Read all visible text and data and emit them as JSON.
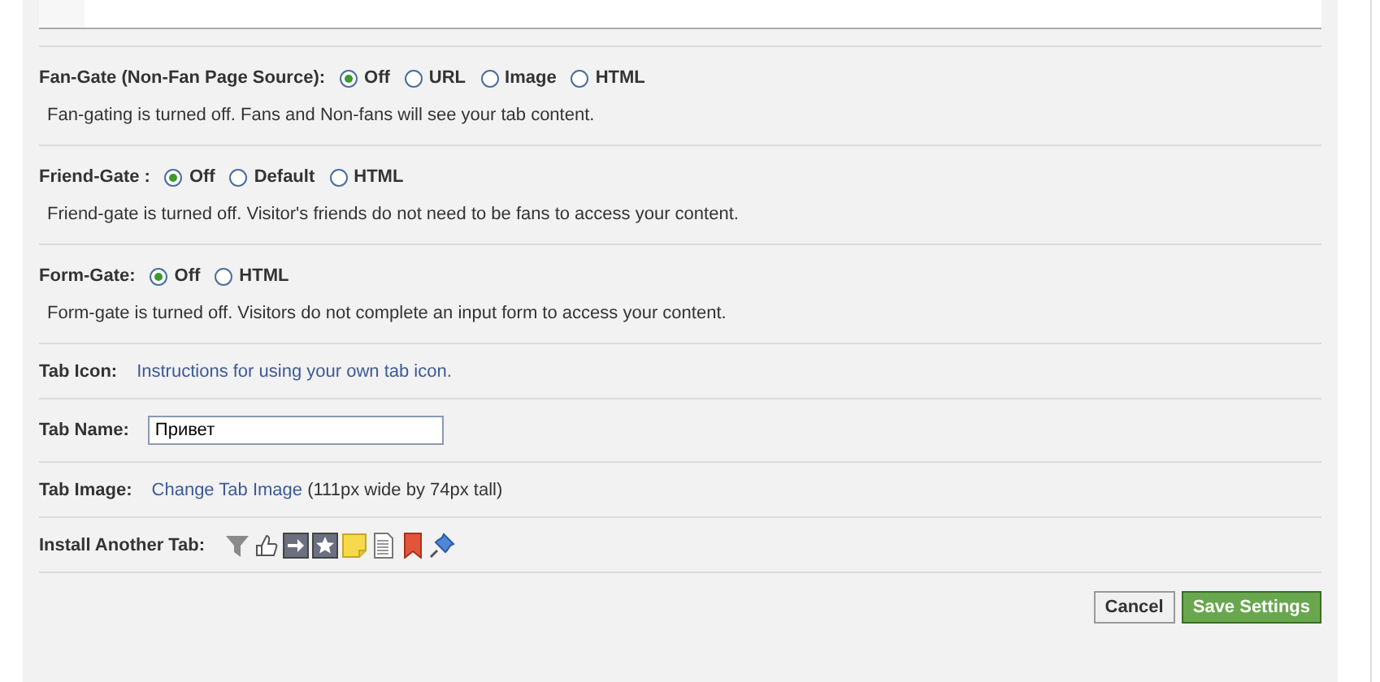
{
  "gates": [
    {
      "label": "Fan-Gate (Non-Fan Page Source):",
      "options": [
        {
          "label": "Off",
          "selected": true
        },
        {
          "label": "URL",
          "selected": false
        },
        {
          "label": "Image",
          "selected": false
        },
        {
          "label": "HTML",
          "selected": false
        }
      ],
      "description": "Fan-gating is turned off. Fans and Non-fans will see your tab content."
    },
    {
      "label": "Friend-Gate :",
      "options": [
        {
          "label": "Off",
          "selected": true
        },
        {
          "label": "Default",
          "selected": false
        },
        {
          "label": "HTML",
          "selected": false
        }
      ],
      "description": "Friend-gate is turned off. Visitor's friends do not need to be fans to access your content."
    },
    {
      "label": "Form-Gate:",
      "options": [
        {
          "label": "Off",
          "selected": true
        },
        {
          "label": "HTML",
          "selected": false
        }
      ],
      "description": "Form-gate is turned off. Visitors do not complete an input form to access your content."
    }
  ],
  "settings": [
    {
      "kind": "link",
      "label": "Tab Icon:",
      "link": "Instructions for using your own tab icon."
    },
    {
      "kind": "input",
      "label": "Tab Name:",
      "value": "Привет"
    },
    {
      "kind": "link",
      "label": "Tab Image:",
      "link": "Change Tab Image",
      "note": "(111px wide by 74px tall)"
    },
    {
      "kind": "icons",
      "label": "Install Another Tab:"
    }
  ],
  "buttons": [
    {
      "label": "Cancel",
      "kind": "secondary"
    },
    {
      "label": "Save Settings",
      "kind": "primary"
    }
  ]
}
